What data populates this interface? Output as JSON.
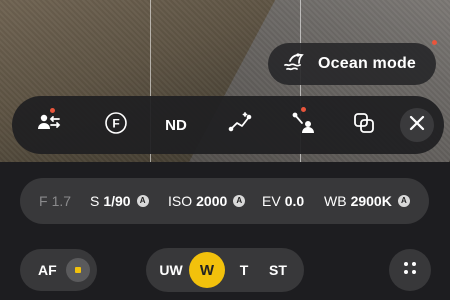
{
  "ocean_mode": {
    "label": "Ocean mode",
    "icon": "ocean-mode-icon"
  },
  "toolbar": {
    "items": [
      {
        "icon": "picture-profile-icon",
        "has_dot": true
      },
      {
        "icon": "f-aperture-icon",
        "text": "F"
      },
      {
        "icon": "nd-filter",
        "text": "ND"
      },
      {
        "icon": "curve-edit-icon"
      },
      {
        "icon": "curve-adjust-icon",
        "has_dot": true
      },
      {
        "icon": "overlap-icon"
      },
      {
        "icon": "close-icon"
      }
    ]
  },
  "settings": {
    "f": {
      "key": "F",
      "value": "1.7"
    },
    "shutter": {
      "key": "S",
      "value": "1/90",
      "auto": "A"
    },
    "iso": {
      "key": "ISO",
      "value": "2000",
      "auto": "A"
    },
    "ev": {
      "key": "EV",
      "value": "0.0"
    },
    "wb": {
      "key": "WB",
      "value": "2900K",
      "auto": "A"
    }
  },
  "af": {
    "label": "AF"
  },
  "lenses": {
    "uw": "UW",
    "w": "W",
    "t": "T",
    "st": "ST",
    "selected": "W"
  },
  "colors": {
    "accent": "#f2c10c",
    "notification_dot": "#e8553c",
    "pill_bg": "#38383a"
  }
}
